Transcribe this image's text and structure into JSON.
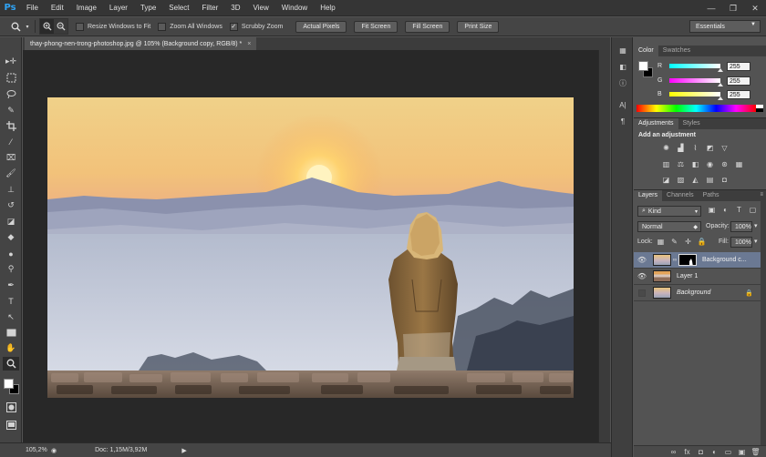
{
  "app": {
    "logo": "Ps"
  },
  "menu": [
    "File",
    "Edit",
    "Image",
    "Layer",
    "Type",
    "Select",
    "Filter",
    "3D",
    "View",
    "Window",
    "Help"
  ],
  "window_controls": {
    "minimize": "—",
    "restore": "❐",
    "close": "✕"
  },
  "options_bar": {
    "tool_icon": "zoom-icon",
    "checkboxes": [
      {
        "label": "Resize Windows to Fit",
        "checked": false
      },
      {
        "label": "Zoom All Windows",
        "checked": false
      },
      {
        "label": "Scrubby Zoom",
        "checked": true
      }
    ],
    "buttons": [
      "Actual Pixels",
      "Fit Screen",
      "Fill Screen",
      "Print Size"
    ],
    "workspace": "Essentials"
  },
  "document": {
    "tab_title": "thay-phong-nen-trong-photoshop.jpg @ 105% (Background copy, RGB/8) *",
    "close": "×"
  },
  "status_bar": {
    "zoom": "105,2%",
    "doc": "Doc: 1,15M/3,92M",
    "arrow": "▶"
  },
  "colors": {
    "accent": "#2fa3f5",
    "foreground": "#ffffff",
    "background": "#000000",
    "selected_layer": "#6b7993"
  },
  "color_panel": {
    "tabs": [
      "Color",
      "Swatches"
    ],
    "channels": [
      {
        "label": "R",
        "value": "255"
      },
      {
        "label": "G",
        "value": "255"
      },
      {
        "label": "B",
        "value": "255"
      }
    ]
  },
  "adjustments_panel": {
    "tabs": [
      "Adjustments",
      "Styles"
    ],
    "title": "Add an adjustment"
  },
  "layers_panel": {
    "tabs": [
      "Layers",
      "Channels",
      "Paths"
    ],
    "filter_kind": "Kind",
    "blend_mode": "Normal",
    "opacity_label": "Opacity:",
    "opacity_value": "100%",
    "lock_label": "Lock:",
    "fill_label": "Fill:",
    "fill_value": "100%",
    "layers": [
      {
        "name": "Background c...",
        "visible": true,
        "selected": true,
        "has_mask": true
      },
      {
        "name": "Layer 1",
        "visible": true,
        "selected": false,
        "has_mask": false
      },
      {
        "name": "Background",
        "visible": false,
        "selected": false,
        "has_mask": false,
        "locked": true
      }
    ]
  }
}
